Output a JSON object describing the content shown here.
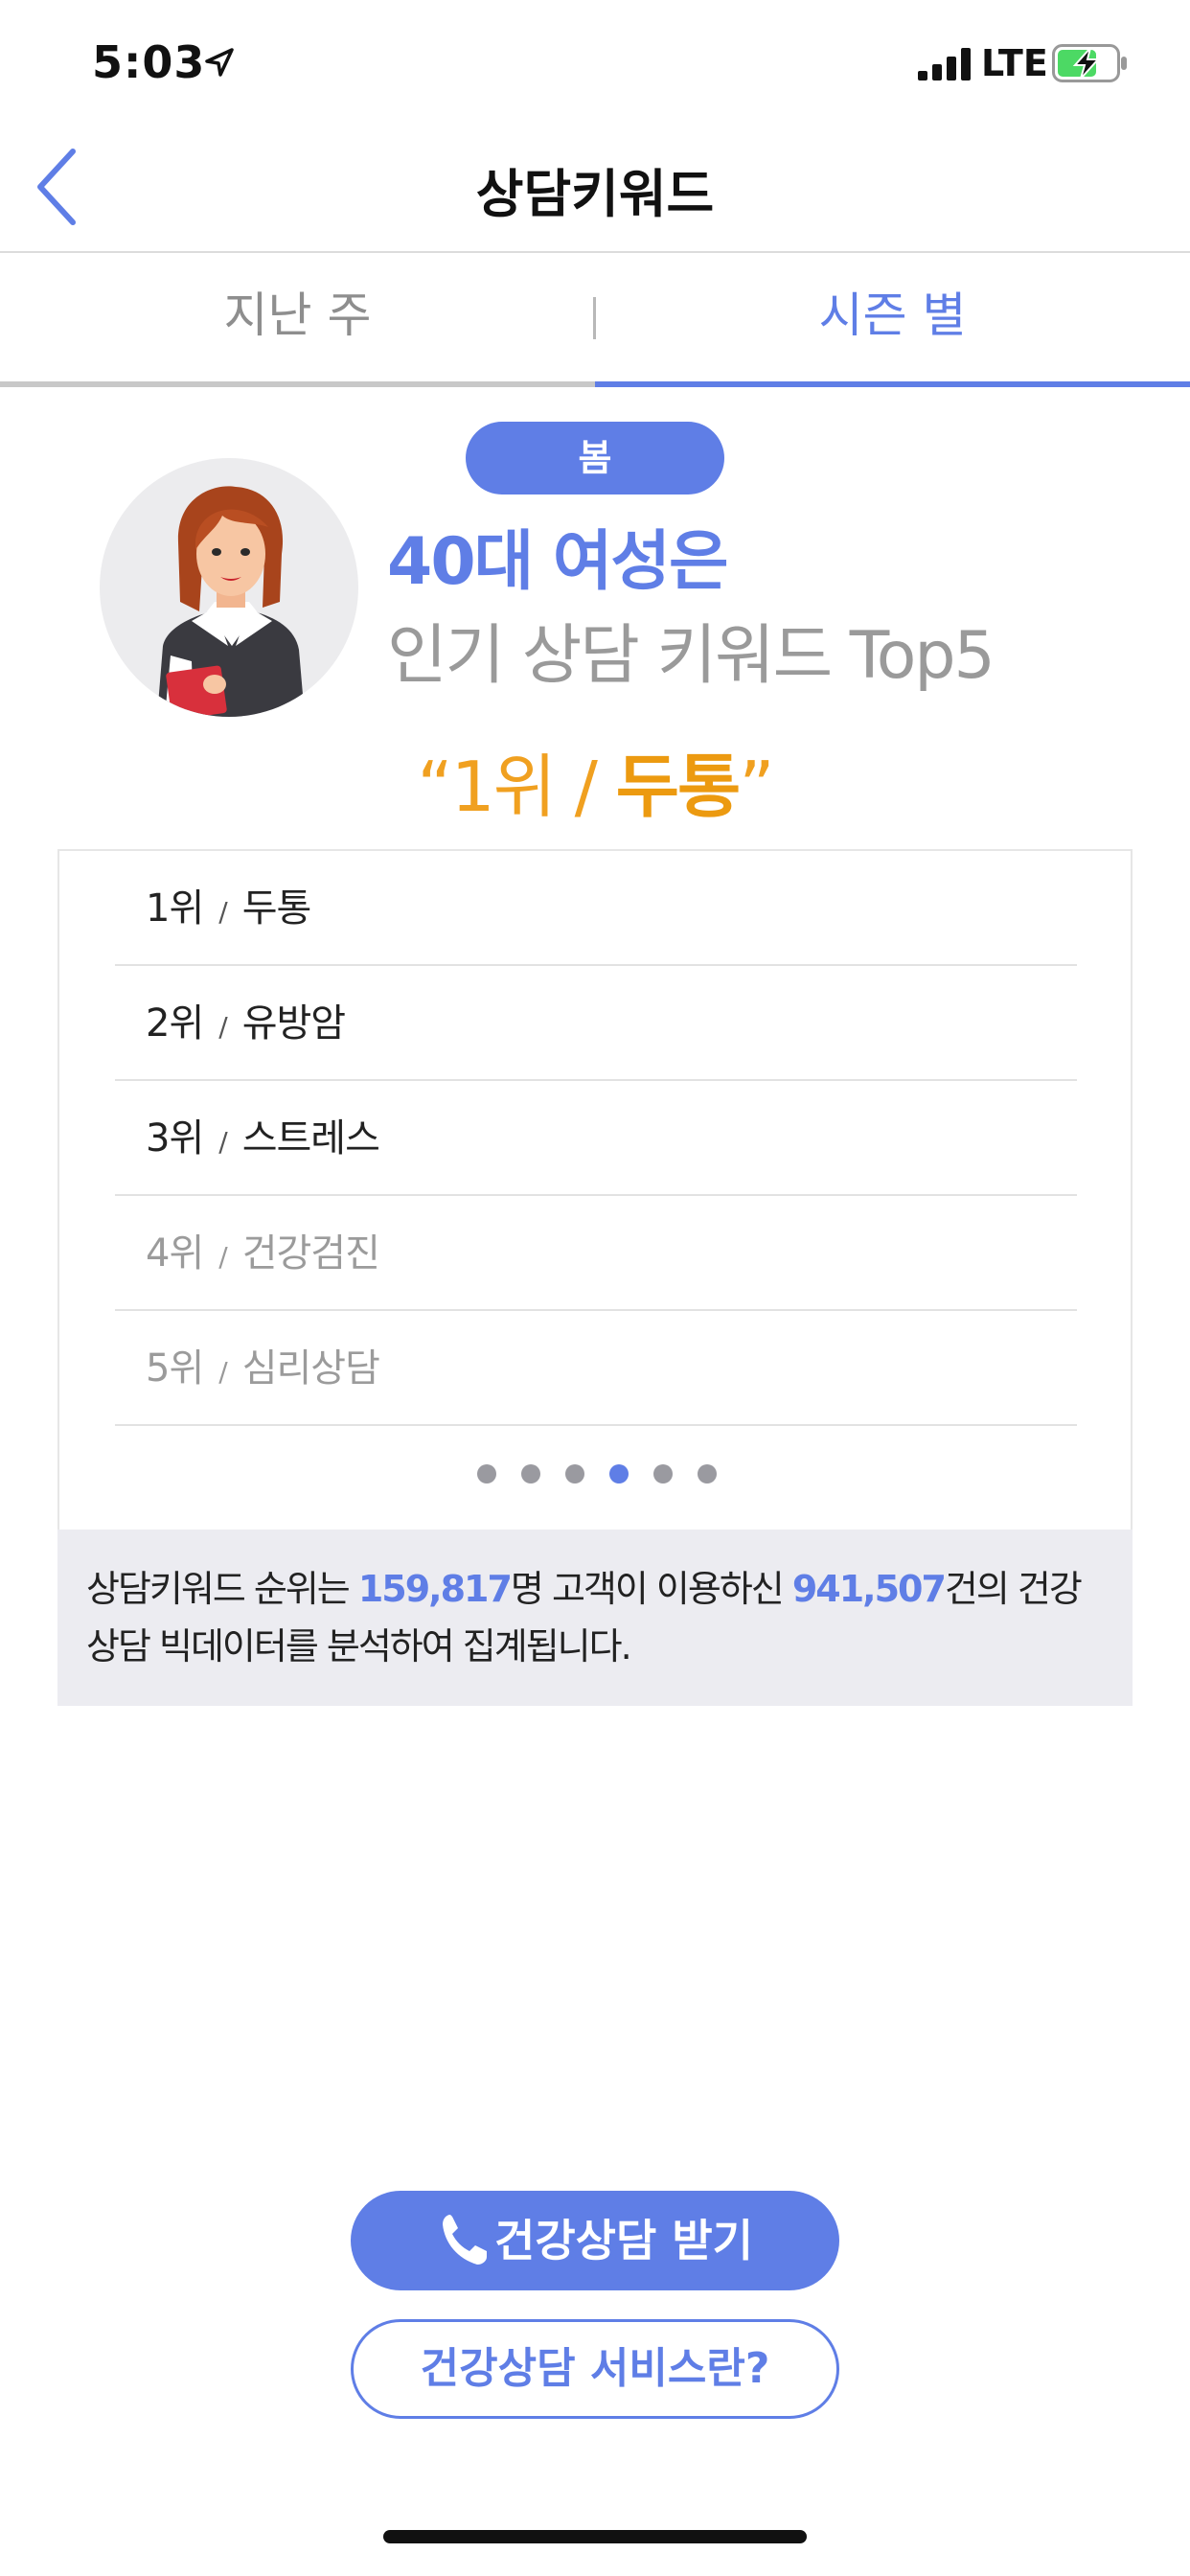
{
  "status_bar": {
    "time": "5:03",
    "network": "LTE"
  },
  "nav": {
    "title": "상담키워드"
  },
  "tabs": [
    {
      "label": "지난 주"
    },
    {
      "label": "시즌 별"
    }
  ],
  "season": {
    "label": "봄"
  },
  "headline": {
    "title": "40대 여성은",
    "subtitle": "인기 상담 키워드 Top5"
  },
  "top_quote": {
    "open": "“1위 / ",
    "keyword": "두통",
    "close": "”"
  },
  "rankings": [
    {
      "rank": "1위",
      "keyword": "두통"
    },
    {
      "rank": "2위",
      "keyword": "유방암"
    },
    {
      "rank": "3위",
      "keyword": "스트레스"
    },
    {
      "rank": "4위",
      "keyword": "건강검진"
    },
    {
      "rank": "5위",
      "keyword": "심리상담"
    }
  ],
  "separator": "/",
  "pagination": {
    "total": 6,
    "active_index": 3
  },
  "info": {
    "prefix": "상담키워드 순위는 ",
    "customers": "159,817",
    "middle": "명 고객이 이용하신 ",
    "consultations": "941,507",
    "suffix": "건의 건강상담 빅데이터를 분석하여 집계됩니다."
  },
  "buttons": {
    "primary": "건강상담 받기",
    "secondary": "건강상담 서비스란?"
  },
  "colors": {
    "accent": "#5f7ee6",
    "highlight": "#ec9a10",
    "muted": "#9a9a9a"
  }
}
